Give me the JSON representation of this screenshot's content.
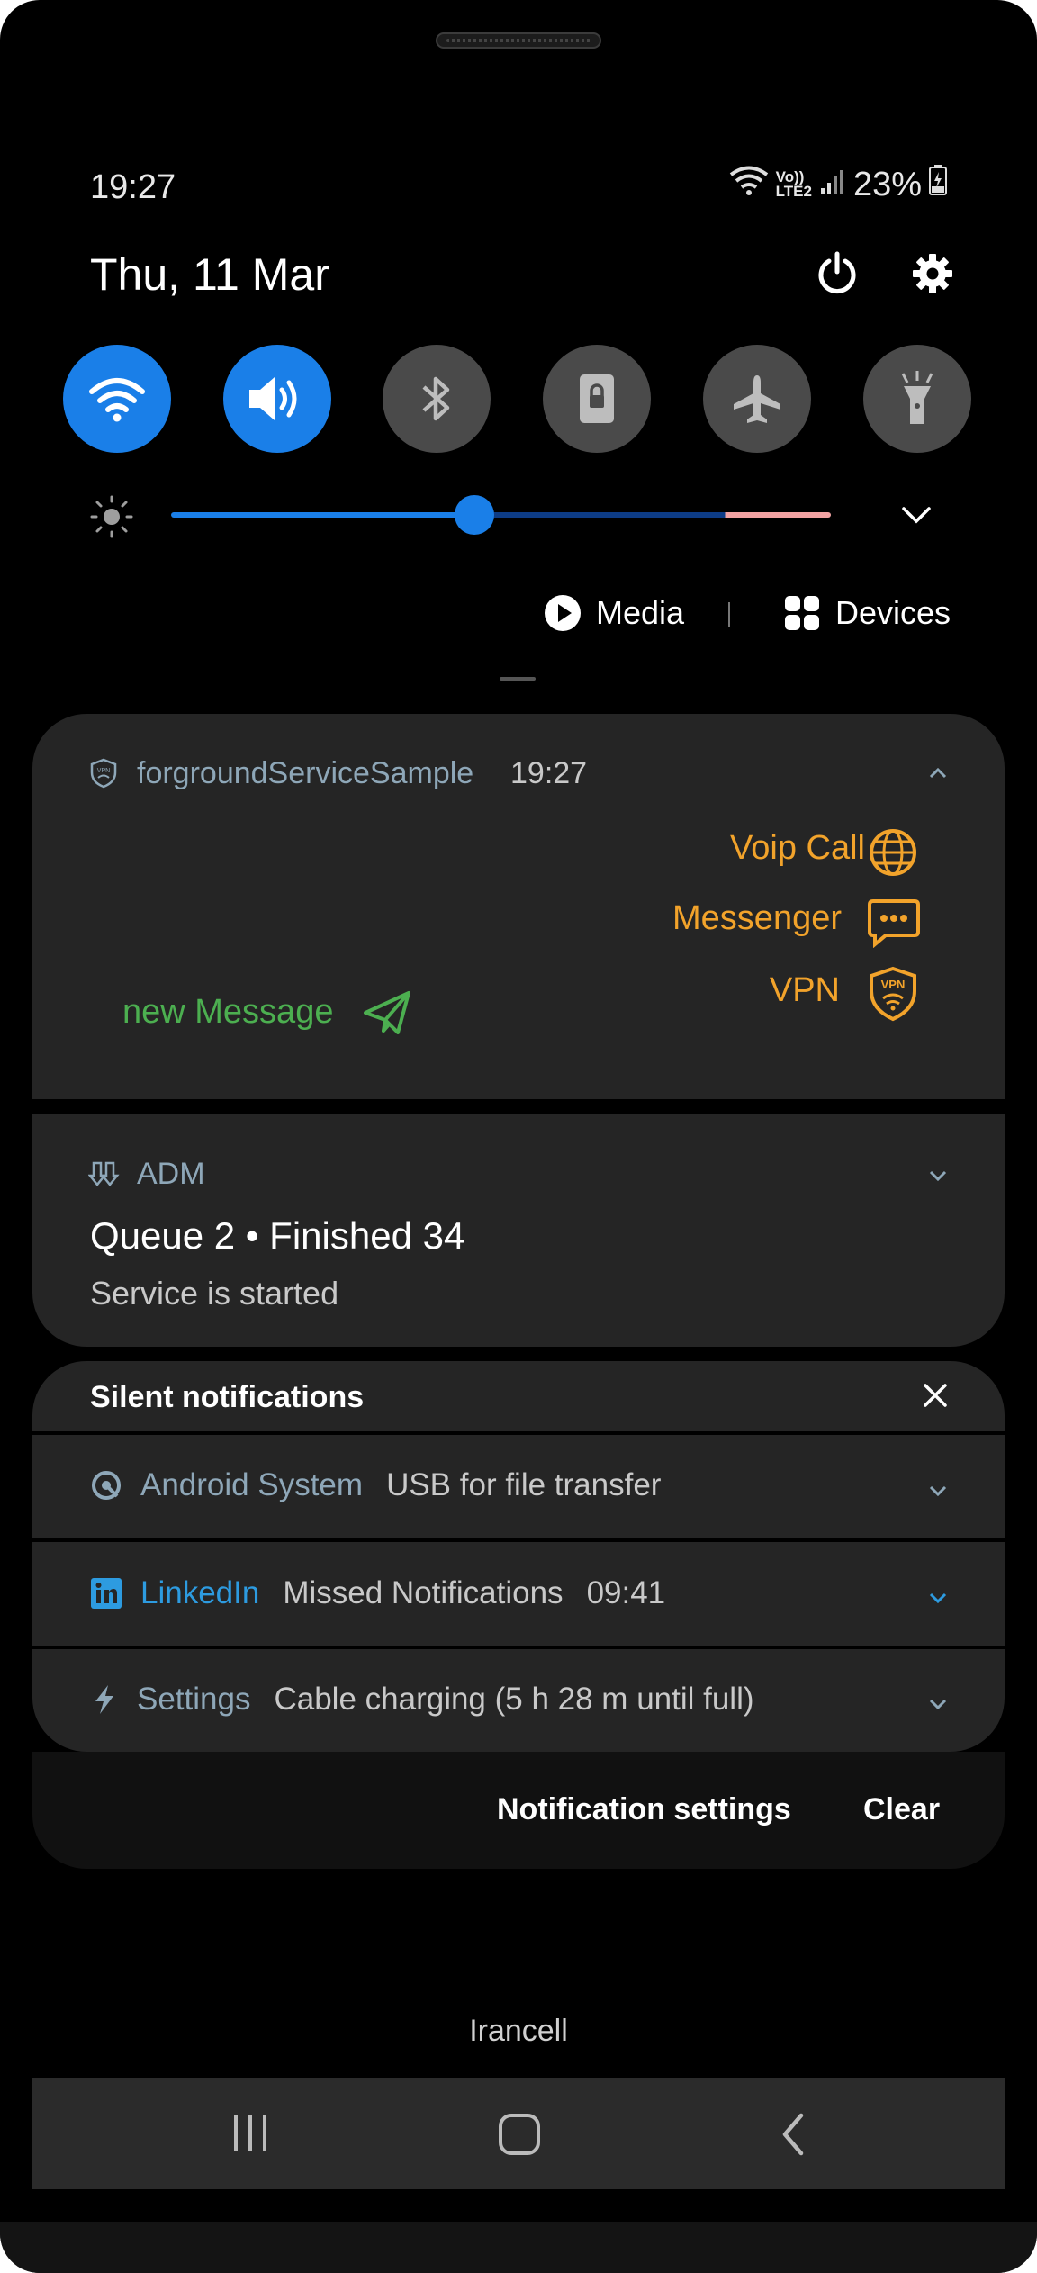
{
  "status_bar": {
    "time": "19:27",
    "network_label_top": "Vo))",
    "network_label_bottom": "LTE2",
    "battery": "23%"
  },
  "header": {
    "date": "Thu, 11 Mar"
  },
  "quick_tiles": [
    {
      "name": "wifi-icon",
      "state": "on"
    },
    {
      "name": "sound-icon",
      "state": "on"
    },
    {
      "name": "bluetooth-icon",
      "state": "off"
    },
    {
      "name": "portrait-lock-icon",
      "state": "off"
    },
    {
      "name": "airplane-icon",
      "state": "off"
    },
    {
      "name": "flashlight-icon",
      "state": "off"
    }
  ],
  "brightness": {
    "level": 0.46
  },
  "media_bar": {
    "media_label": "Media",
    "devices_label": "Devices"
  },
  "notif_fg": {
    "app_name": "forgroundServiceSample",
    "time": "19:27",
    "actions": [
      {
        "label": "Voip Call",
        "icon": "globe-icon"
      },
      {
        "label": "Messenger",
        "icon": "chat-icon"
      },
      {
        "label": "VPN",
        "icon": "vpn-shield-icon"
      }
    ],
    "new_message_label": "new Message"
  },
  "notif_adm": {
    "app_name": "ADM",
    "title": "Queue 2 • Finished 34",
    "text": "Service is started"
  },
  "silent": {
    "header": "Silent notifications",
    "rows": [
      {
        "app": "Android System",
        "text": "USB for file transfer",
        "time": ""
      },
      {
        "app": "LinkedIn",
        "text": "Missed Notifications",
        "time": "09:41"
      },
      {
        "app": "Settings",
        "text": "Cable charging (5 h 28 m until full)",
        "time": ""
      }
    ]
  },
  "footer_actions": {
    "settings": "Notification settings",
    "clear": "Clear"
  },
  "carrier": "Irancell",
  "colors": {
    "accent_blue": "#1a7fe8",
    "orange": "#f2a32b",
    "green": "#4caf50",
    "app_name_color": "#8ea7b8",
    "linkedin_blue": "#2d9be0"
  }
}
